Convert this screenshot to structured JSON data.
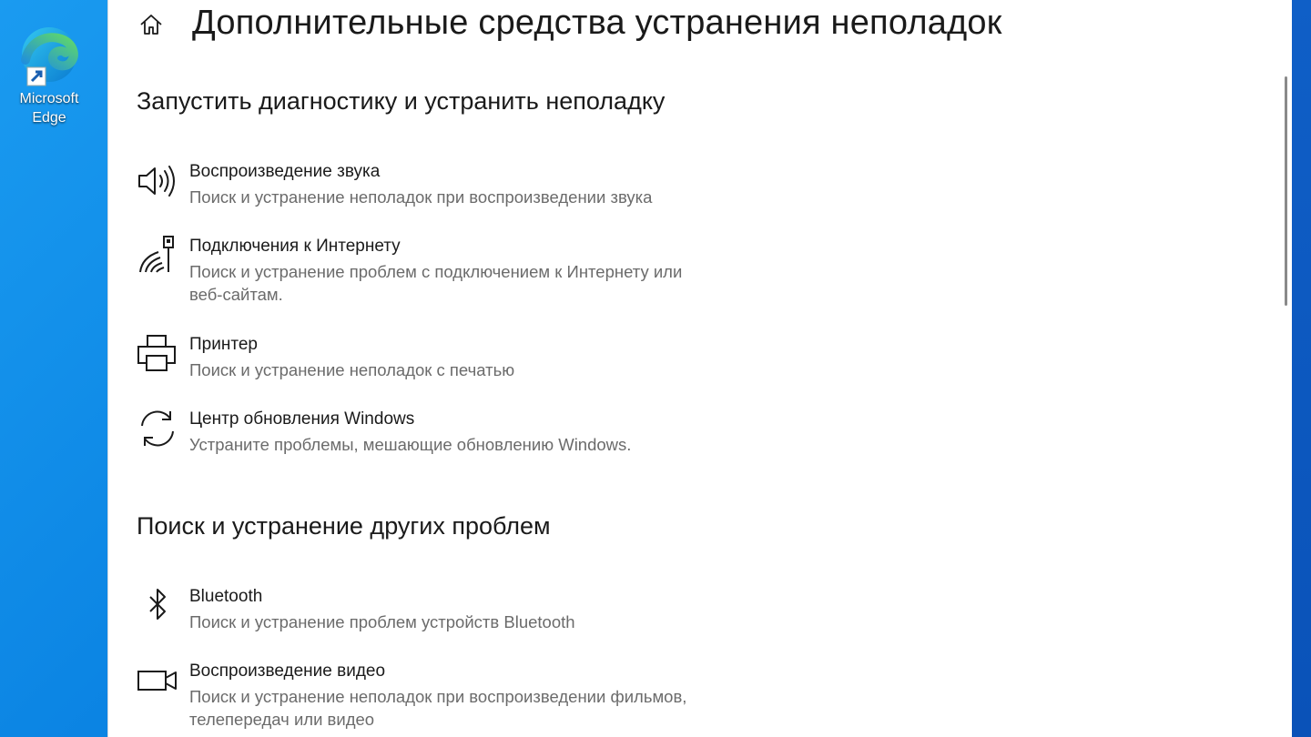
{
  "desktop": {
    "icons": [
      {
        "label_line1": "Microsoft",
        "label_line2": "Edge",
        "icon": "edge-icon"
      }
    ]
  },
  "window": {
    "page_title": "Дополнительные средства устранения неполадок",
    "home_icon": "home-icon"
  },
  "sections": [
    {
      "title": "Запустить диагностику и устранить неполадку",
      "items": [
        {
          "title": "Воспроизведение звука",
          "description": "Поиск и устранение неполадок при воспроизведении звука",
          "icon": "speaker-icon"
        },
        {
          "title": "Подключения к Интернету",
          "description": "Поиск и устранение проблем с подключением к Интернету или веб-сайтам.",
          "icon": "network-icon"
        },
        {
          "title": "Принтер",
          "description": "Поиск и устранение неполадок с печатью",
          "icon": "printer-icon"
        },
        {
          "title": "Центр обновления Windows",
          "description": "Устраните проблемы, мешающие обновлению Windows.",
          "icon": "sync-icon"
        }
      ]
    },
    {
      "title": "Поиск и устранение других проблем",
      "items": [
        {
          "title": "Bluetooth",
          "description": "Поиск и устранение проблем устройств Bluetooth",
          "icon": "bluetooth-icon"
        },
        {
          "title": "Воспроизведение видео",
          "description": "Поиск и устранение неполадок при воспроизведении фильмов, телепередач или видео",
          "icon": "video-camera-icon"
        }
      ]
    }
  ],
  "colors": {
    "desktop_bg": "#0b84e3",
    "window_bg": "#ffffff",
    "text_primary": "#1a1a1a",
    "text_secondary": "#6b6b6b"
  }
}
